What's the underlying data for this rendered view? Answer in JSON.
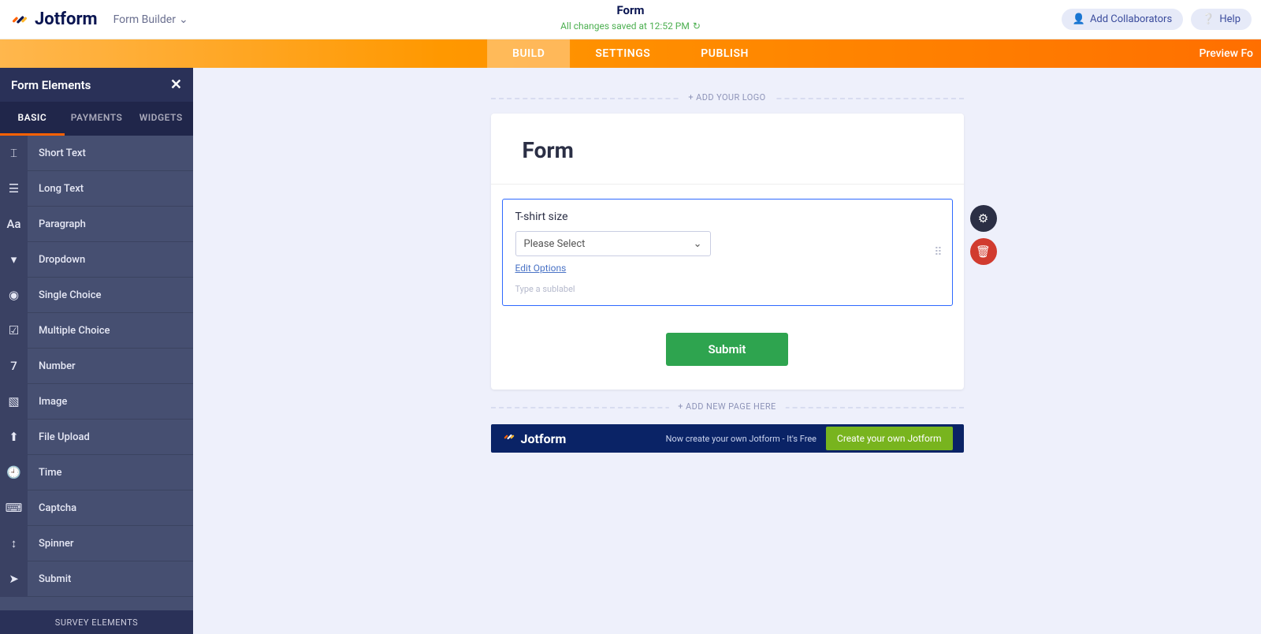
{
  "brand": "Jotform",
  "productSelector": "Form Builder",
  "topTitle": "Form",
  "saveStatus": "All changes saved at 12:52 PM",
  "addCollab": "Add Collaborators",
  "help": "Help",
  "mainTabs": {
    "build": "BUILD",
    "settings": "SETTINGS",
    "publish": "PUBLISH"
  },
  "preview": "Preview Fo",
  "sidebar": {
    "title": "Form Elements",
    "tabs": {
      "basic": "BASIC",
      "payments": "PAYMENTS",
      "widgets": "WIDGETS"
    },
    "items": [
      {
        "label": "Short Text",
        "icon": "short-text-icon",
        "glyph": "⌶"
      },
      {
        "label": "Long Text",
        "icon": "long-text-icon",
        "glyph": "☰"
      },
      {
        "label": "Paragraph",
        "icon": "paragraph-icon",
        "glyph": "Aa"
      },
      {
        "label": "Dropdown",
        "icon": "dropdown-icon",
        "glyph": "▾"
      },
      {
        "label": "Single Choice",
        "icon": "radio-icon",
        "glyph": "◉"
      },
      {
        "label": "Multiple Choice",
        "icon": "checkbox-icon",
        "glyph": "☑"
      },
      {
        "label": "Number",
        "icon": "number-icon",
        "glyph": "7"
      },
      {
        "label": "Image",
        "icon": "image-icon",
        "glyph": "▧"
      },
      {
        "label": "File Upload",
        "icon": "upload-icon",
        "glyph": "⬆"
      },
      {
        "label": "Time",
        "icon": "time-icon",
        "glyph": "🕘"
      },
      {
        "label": "Captcha",
        "icon": "captcha-icon",
        "glyph": "⌨"
      },
      {
        "label": "Spinner",
        "icon": "spinner-icon",
        "glyph": "↕"
      },
      {
        "label": "Submit",
        "icon": "submit-icon",
        "glyph": "➤"
      }
    ],
    "section": "SURVEY ELEMENTS"
  },
  "canvas": {
    "addLogo": "+ ADD YOUR LOGO",
    "formTitle": "Form",
    "field": {
      "label": "T-shirt size",
      "placeholder": "Please Select",
      "editOptions": "Edit Options",
      "sublabelPlaceholder": "Type a sublabel"
    },
    "submit": "Submit",
    "addPage": "+ ADD NEW PAGE HERE"
  },
  "promo": {
    "brand": "Jotform",
    "text": "Now create your own Jotform - It's Free",
    "cta": "Create your own Jotform"
  }
}
